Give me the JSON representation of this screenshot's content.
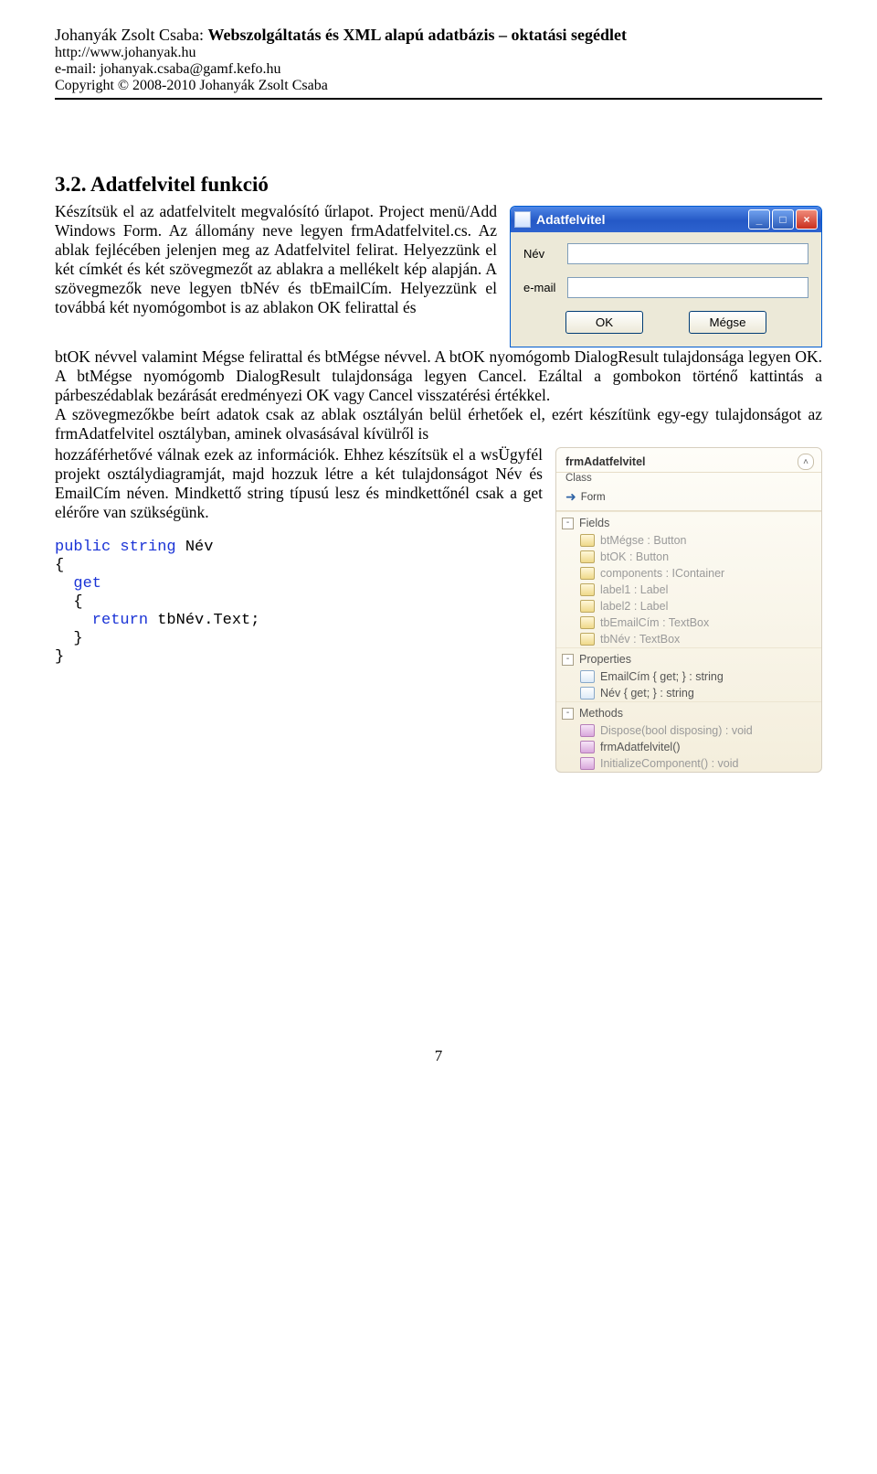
{
  "header": {
    "author": "Johanyák Zsolt Csaba: ",
    "title_bold": "Webszolgáltatás és XML alapú adatbázis – oktatási segédlet",
    "url": "http://www.johanyak.hu",
    "email": "e-mail: johanyak.csaba@gamf.kefo.hu",
    "copyright": "Copyright © 2008-2010 Johanyák Zsolt Csaba"
  },
  "section": {
    "number_title": "3.2. Adatfelvitel funkció"
  },
  "para1": "Készítsük el az adatfelvitelt megvalósító űrlapot. Project menü/Add Windows Form. Az állomány neve legyen frmAdatfelvitel.cs. Az ablak fejlécében jelenjen meg az Adatfelvitel felirat. Helyezzünk el két címkét és két szövegmezőt az ablakra a mellékelt kép alapján. A szövegmezők neve legyen tbNév és tbEmailCím. Helyezzünk el továbbá két nyomógombot is az ablakon OK felirattal és",
  "para1b": "btOK névvel valamint Mégse felirattal és btMégse névvel. A btOK nyomógomb DialogResult tulajdonsága legyen OK. A btMégse nyomógomb DialogResult tulajdonsága legyen Cancel. Ezáltal a gombokon történő kattintás a párbeszédablak bezárását eredményezi OK vagy Cancel visszatérési értékkel.",
  "para2a": "A szövegmezőkbe beírt adatok csak az ablak osztályán belül érhetőek el, ezért készítünk egy-egy tulajdonságot az frmAdatfelvitel osztályban, aminek olvasásával kívülről is",
  "para2b": "hozzáférhetővé válnak ezek az információk. Ehhez készítsük el a wsÜgyfél projekt osztálydiagramját, majd hozzuk létre a két tulajdonságot Név és EmailCím néven. Mindkettő string típusú lesz és mindkettőnél csak a get elérőre van szükségünk.",
  "win": {
    "title": "Adatfelvitel",
    "label_name": "Név",
    "label_email": "e-mail",
    "btn_ok": "OK",
    "btn_cancel": "Mégse",
    "min": "_",
    "max": "□",
    "close": "×"
  },
  "cd": {
    "class_name": "frmAdatfelvitel",
    "class_sub": "Class",
    "inherits": "Form",
    "section_fields": "Fields",
    "section_props": "Properties",
    "section_methods": "Methods",
    "fields": [
      "btMégse : Button",
      "btOK : Button",
      "components : IContainer",
      "label1 : Label",
      "label2 : Label",
      "tbEmailCím : TextBox",
      "tbNév : TextBox"
    ],
    "props": [
      "EmailCím { get; } : string",
      "Név { get; } : string"
    ],
    "methods": [
      "Dispose(bool disposing) : void",
      "frmAdatfelvitel()",
      "InitializeComponent() : void"
    ]
  },
  "code": {
    "l1a": "public",
    "l1b": " string",
    "l1c": " Név",
    "l2": "{",
    "l3": "  get",
    "l4": "  {",
    "l5a": "    return",
    "l5b": " tbNév.Text;",
    "l6": "  }",
    "l7": "}"
  },
  "page_number": "7"
}
